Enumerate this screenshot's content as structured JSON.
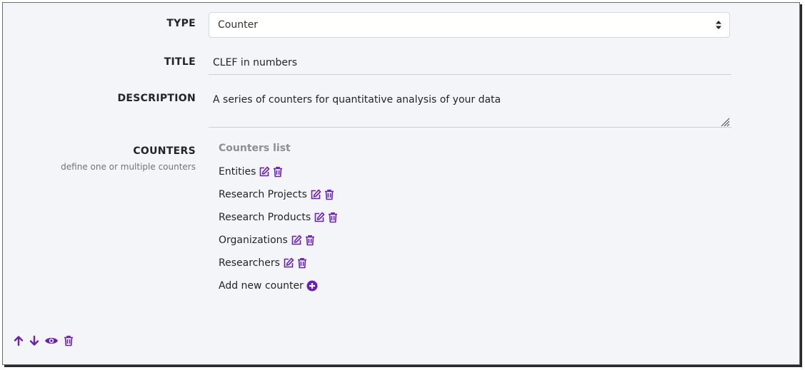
{
  "form": {
    "type_label": "TYPE",
    "type_value": "Counter",
    "title_label": "TITLE",
    "title_value": "CLEF in numbers",
    "description_label": "DESCRIPTION",
    "description_value": "A series of counters for quantitative analysis of your data",
    "counters_label": "COUNTERS",
    "counters_hint": "define one or multiple counters"
  },
  "counters": {
    "list_title": "Counters list",
    "items": [
      "Entities",
      "Research Projects",
      "Research Products",
      "Organizations",
      "Researchers"
    ],
    "add_label": "Add new counter"
  },
  "icons": {
    "edit": "edit-icon",
    "delete": "trash-icon",
    "add": "plus-circle-icon",
    "up": "arrow-up-icon",
    "down": "arrow-down-icon",
    "view": "eye-icon"
  },
  "colors": {
    "accent": "#6a1fb5"
  }
}
